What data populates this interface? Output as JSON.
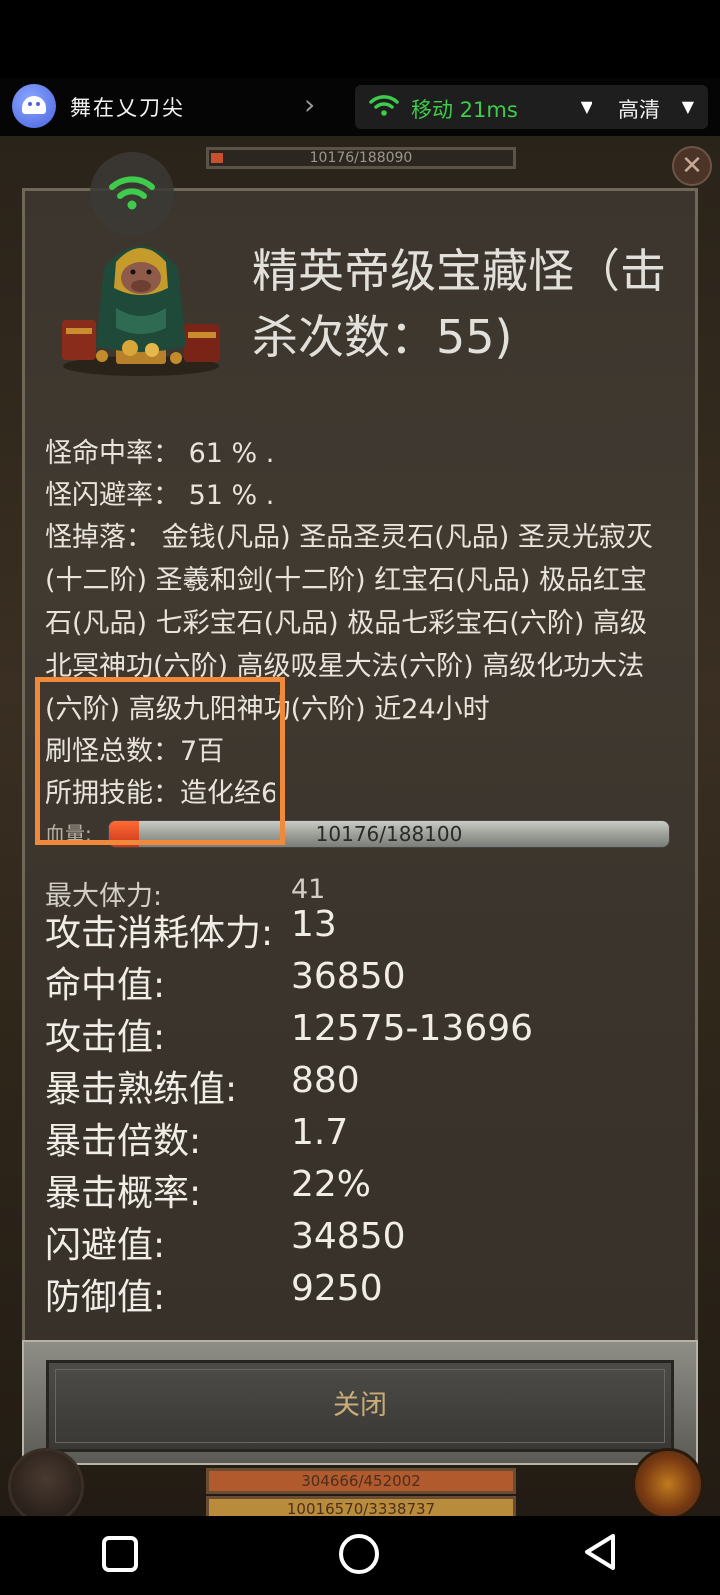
{
  "topbar": {
    "app_title": "舞在乂刀尖",
    "network": "移动 21ms",
    "quality": "高清"
  },
  "game": {
    "top_hp_text": "10176/188090",
    "bottom_bar_a": "304666/452002",
    "bottom_bar_b": "10016570/3338737"
  },
  "monster": {
    "title": "精英帝级宝藏怪（击杀次数：55)",
    "hit_rate": "怪命中率： 61 % .",
    "dodge_rate": "怪闪避率： 51 % .",
    "drops": "怪掉落： 金钱(凡品) 圣品圣灵石(凡品) 圣灵光寂灭(十二阶) 圣羲和剑(十二阶) 红宝石(凡品) 极品红宝石(凡品) 七彩宝石(凡品) 极品七彩宝石(六阶) 高级北冥神功(六阶) 高级吸星大法(六阶) 高级化功大法(六阶) 高级九阳神功(六阶) 近24小时",
    "kill_count": "刷怪总数：7百",
    "skills": "所拥技能：造化经6",
    "hp_label": "血量:",
    "hp_text": "10176/188100",
    "hp_fraction": 0.054
  },
  "stats": [
    {
      "label": "最大体力:",
      "value": "41"
    },
    {
      "label": "攻击消耗体力:",
      "value": "13"
    },
    {
      "label": "命中值:",
      "value": "36850"
    },
    {
      "label": "攻击值:",
      "value": "12575-13696"
    },
    {
      "label": "暴击熟练值:",
      "value": "880"
    },
    {
      "label": "暴击倍数:",
      "value": "1.7"
    },
    {
      "label": "暴击概率:",
      "value": "22%"
    },
    {
      "label": "闪避值:",
      "value": "34850"
    },
    {
      "label": "防御值:",
      "value": "9250"
    }
  ],
  "close_button": "关闭",
  "icons": {
    "wifi": "wifi-icon",
    "android": "android-icon",
    "nav_square": "recent-apps-icon",
    "nav_circle": "home-icon",
    "nav_back": "back-icon"
  },
  "colors": {
    "accent_green": "#3fcb4b",
    "highlight_orange": "#f08a3a",
    "hp_red": "#e24a22"
  }
}
